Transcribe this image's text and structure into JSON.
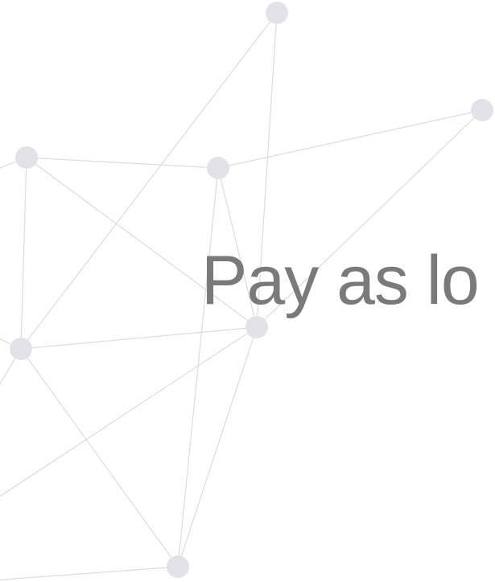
{
  "headline": {
    "text": "Pay as lo"
  },
  "colors": {
    "background": "#ffffff",
    "headline": "#7a7a7a",
    "node": "#e3e2e8",
    "edge": "#dcdce0"
  }
}
